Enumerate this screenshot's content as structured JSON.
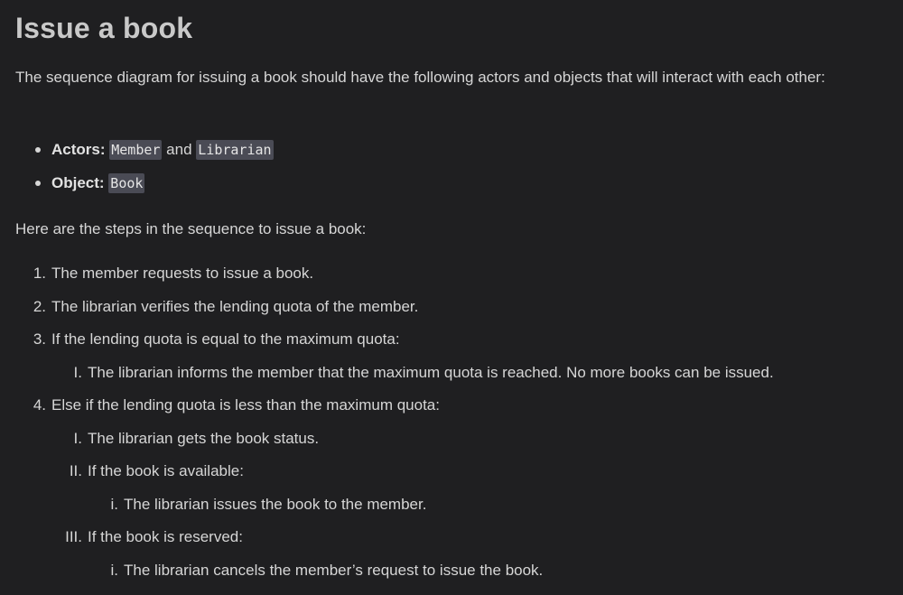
{
  "heading": "Issue a book",
  "intro": "The sequence diagram for issuing a book should have the following actors and objects that will interact with each other:",
  "bullets": {
    "actors_label": "Actors:",
    "actor_member": "Member",
    "actors_and": "and",
    "actor_librarian": "Librarian",
    "object_label": "Object:",
    "object_book": "Book"
  },
  "steps_intro": "Here are the steps in the sequence to issue a book:",
  "steps": [
    {
      "marker": "1.",
      "text": "The member requests to issue a book."
    },
    {
      "marker": "2.",
      "text": "The librarian verifies the lending quota of the member."
    },
    {
      "marker": "3.",
      "text": "If the lending quota is equal to the maximum quota:"
    },
    {
      "marker": "I.",
      "text": "The librarian informs the member that the maximum quota is reached. No more books can be issued."
    },
    {
      "marker": "4.",
      "text": "Else if the lending quota is less than the maximum quota:"
    },
    {
      "marker": "I.",
      "text": "The librarian gets the book status."
    },
    {
      "marker": "II.",
      "text": "If the book is available:"
    },
    {
      "marker": "i.",
      "text": "The librarian issues the book to the member."
    },
    {
      "marker": "III.",
      "text": "If the book is reserved:"
    },
    {
      "marker": "i.",
      "text": "The librarian cancels the member’s request to issue the book."
    }
  ]
}
